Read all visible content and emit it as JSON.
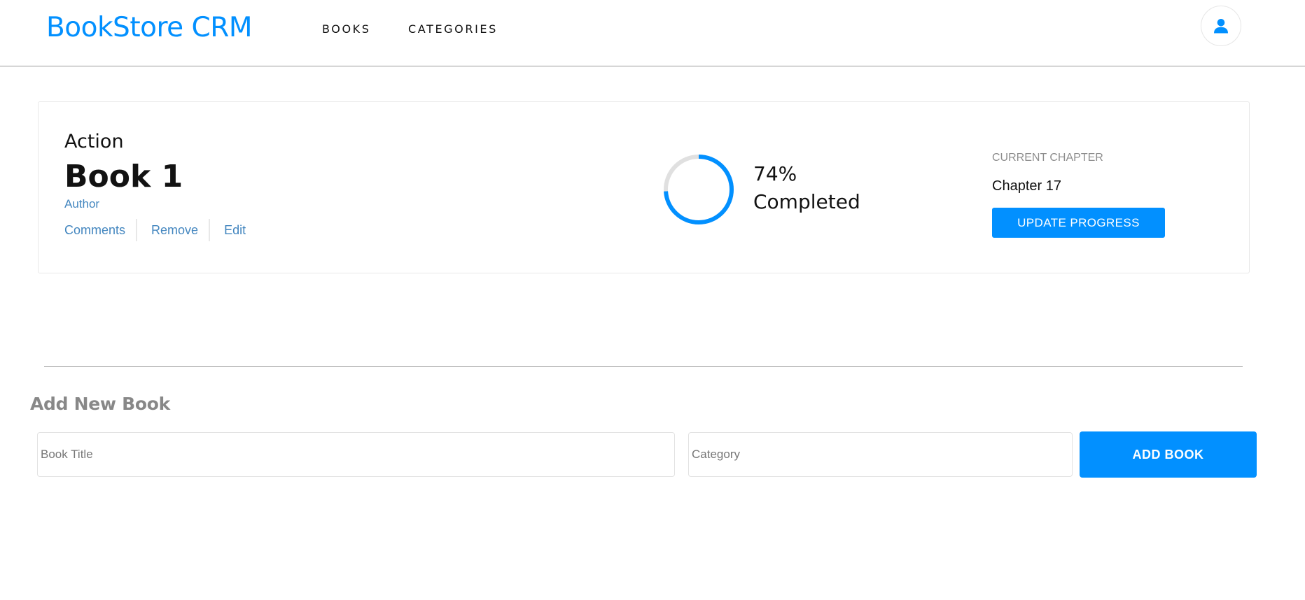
{
  "header": {
    "logo": "BookStore CRM",
    "nav": [
      "BOOKS",
      "CATEGORIES"
    ],
    "user_icon": "user-icon"
  },
  "book": {
    "genre": "Action",
    "title": "Book 1",
    "author": "Author",
    "actions": [
      "Comments",
      "Remove",
      "Edit"
    ],
    "progress": 0.74,
    "percent_label": "74%",
    "completed_label": "Completed",
    "chapter_label": "CURRENT CHAPTER",
    "chapter_value": "Chapter 17",
    "update_button": "UPDATE PROGRESS"
  },
  "add_book": {
    "heading": "Add New Book",
    "title_placeholder": "Book Title",
    "category_placeholder": "Category",
    "button": "ADD BOOK"
  },
  "colors": {
    "accent": "#0290ff",
    "link": "#4386bf",
    "ring_track": "#e0e0e0"
  }
}
